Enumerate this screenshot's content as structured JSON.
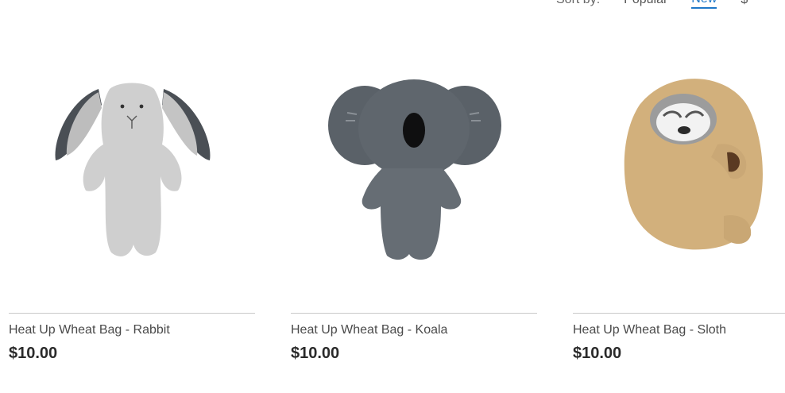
{
  "sort": {
    "label": "Sort by:",
    "options": [
      "Popular",
      "New",
      "$"
    ],
    "active": "New"
  },
  "products": [
    {
      "name": "Heat Up Wheat Bag - Rabbit",
      "price": "$10.00",
      "image_icon": "rabbit-plush-icon"
    },
    {
      "name": "Heat Up Wheat Bag - Koala",
      "price": "$10.00",
      "image_icon": "koala-plush-icon"
    },
    {
      "name": "Heat Up Wheat Bag - Sloth",
      "price": "$10.00",
      "image_icon": "sloth-plush-icon"
    }
  ],
  "colors": {
    "accent": "#1f78c8",
    "divider": "#c9c9c9",
    "rabbit_body": "#cfcfcf",
    "rabbit_ear_inner": "#4a4f55",
    "koala_body": "#5f666d",
    "sloth_fur": "#d2b07c"
  }
}
